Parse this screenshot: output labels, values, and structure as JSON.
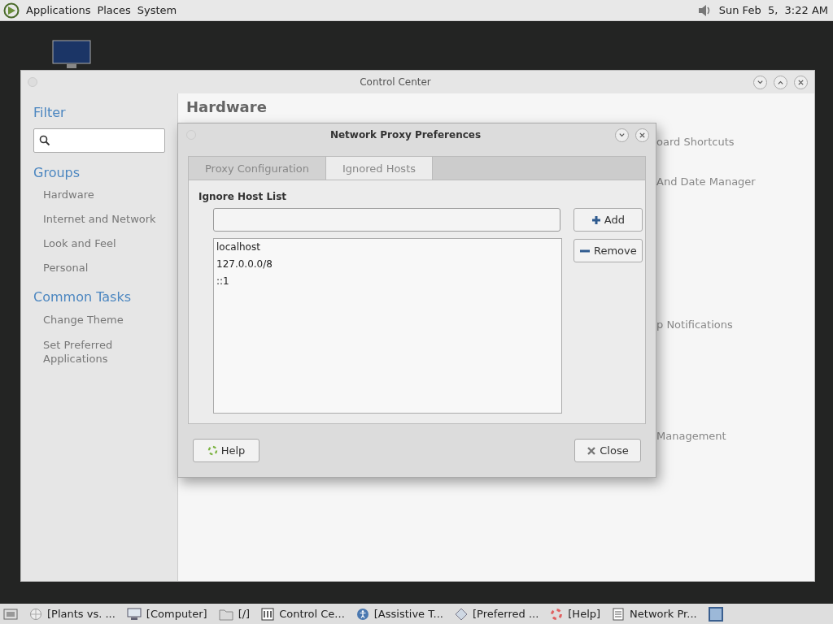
{
  "top_panel": {
    "menus": [
      "Applications",
      "Places",
      "System"
    ],
    "clock": "Sun Feb  5,  3:22 AM"
  },
  "control_center": {
    "title": "Control Center",
    "filter": {
      "heading": "Filter"
    },
    "groups": {
      "heading": "Groups",
      "items": [
        {
          "label": "Hardware"
        },
        {
          "label": "Internet and Network"
        },
        {
          "label": "Look and Feel"
        },
        {
          "label": "Personal"
        }
      ]
    },
    "common_tasks": {
      "heading": "Common Tasks",
      "items": [
        {
          "label": "Change Theme"
        },
        {
          "label": "Set Preferred Applications"
        }
      ]
    },
    "section_title": "Hardware",
    "visible_items": [
      "oard Shortcuts",
      "And Date Manager",
      "p Notifications",
      "Management"
    ]
  },
  "dialog": {
    "title": "Network Proxy Preferences",
    "tabs": [
      {
        "label": "Proxy Configuration",
        "selected": false
      },
      {
        "label": "Ignored Hosts",
        "selected": true
      }
    ],
    "list_label": "Ignore Host List",
    "hosts": [
      "localhost",
      "127.0.0.0/8",
      "::1"
    ],
    "buttons": {
      "add": "Add",
      "remove": "Remove",
      "help": "Help",
      "close": "Close"
    }
  },
  "taskbar": [
    {
      "label": "[Plants vs. ...",
      "kind": "globe"
    },
    {
      "label": "[Computer]",
      "kind": "computer"
    },
    {
      "label": "[/]",
      "kind": "folder"
    },
    {
      "label": "Control Ce...",
      "kind": "panel"
    },
    {
      "label": "[Assistive T...",
      "kind": "access"
    },
    {
      "label": "[Preferred ...",
      "kind": "diamond"
    },
    {
      "label": "[Help]",
      "kind": "help"
    },
    {
      "label": "Network Pr...",
      "kind": "doc"
    }
  ]
}
